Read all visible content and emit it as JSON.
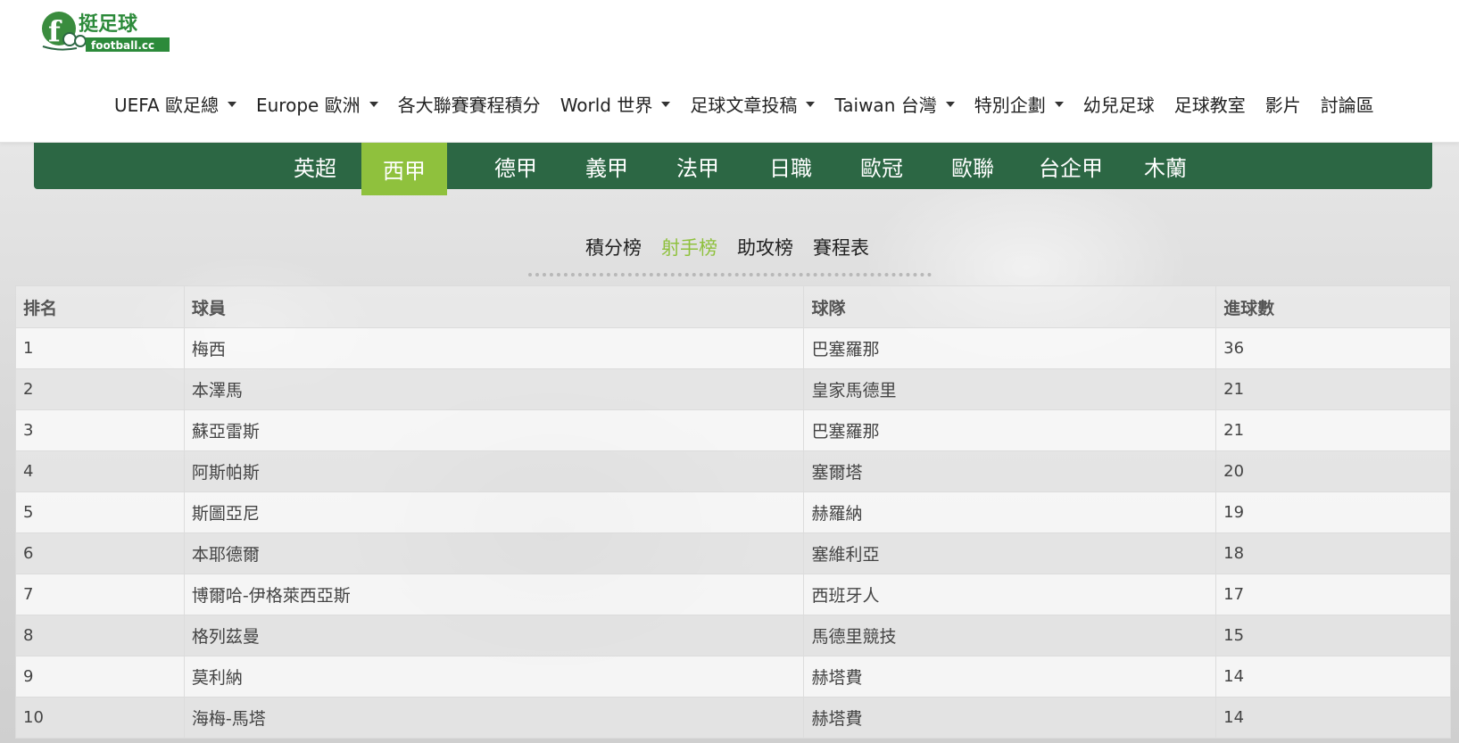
{
  "logo": {
    "text_cn": "挺足球",
    "text_en": "football.cc"
  },
  "nav": {
    "items": [
      {
        "label": "UEFA 歐足總",
        "dropdown": true
      },
      {
        "label": "Europe 歐洲",
        "dropdown": true
      },
      {
        "label": "各大聯賽賽程積分",
        "dropdown": false
      },
      {
        "label": "World 世界",
        "dropdown": true
      },
      {
        "label": "足球文章投稿",
        "dropdown": true
      },
      {
        "label": "Taiwan 台灣",
        "dropdown": true
      },
      {
        "label": "特別企劃",
        "dropdown": true
      },
      {
        "label": "幼兒足球",
        "dropdown": false
      },
      {
        "label": "足球教室",
        "dropdown": false
      },
      {
        "label": "影片",
        "dropdown": false
      },
      {
        "label": "討論區",
        "dropdown": false
      }
    ]
  },
  "leagues": {
    "active": "西甲",
    "items": [
      "英超",
      "西甲",
      "德甲",
      "義甲",
      "法甲",
      "日職",
      "歐冠",
      "歐聯",
      "台企甲",
      "木蘭"
    ]
  },
  "subtabs": {
    "active": "射手榜",
    "items": [
      "積分榜",
      "射手榜",
      "助攻榜",
      "賽程表"
    ]
  },
  "table": {
    "headers": [
      "排名",
      "球員",
      "球隊",
      "進球數"
    ],
    "rows": [
      [
        "1",
        "梅西",
        "巴塞羅那",
        "36"
      ],
      [
        "2",
        "本澤馬",
        "皇家馬德里",
        "21"
      ],
      [
        "3",
        "蘇亞雷斯",
        "巴塞羅那",
        "21"
      ],
      [
        "4",
        "阿斯帕斯",
        "塞爾塔",
        "20"
      ],
      [
        "5",
        "斯圖亞尼",
        "赫羅納",
        "19"
      ],
      [
        "6",
        "本耶德爾",
        "塞維利亞",
        "18"
      ],
      [
        "7",
        "博爾哈-伊格萊西亞斯",
        "西班牙人",
        "17"
      ],
      [
        "8",
        "格列茲曼",
        "馬德里競技",
        "15"
      ],
      [
        "9",
        "莫利納",
        "赫塔費",
        "14"
      ],
      [
        "10",
        "海梅-馬塔",
        "赫塔費",
        "14"
      ]
    ]
  },
  "colors": {
    "brand_green": "#2c6744",
    "accent_lime": "#8fc13d"
  }
}
